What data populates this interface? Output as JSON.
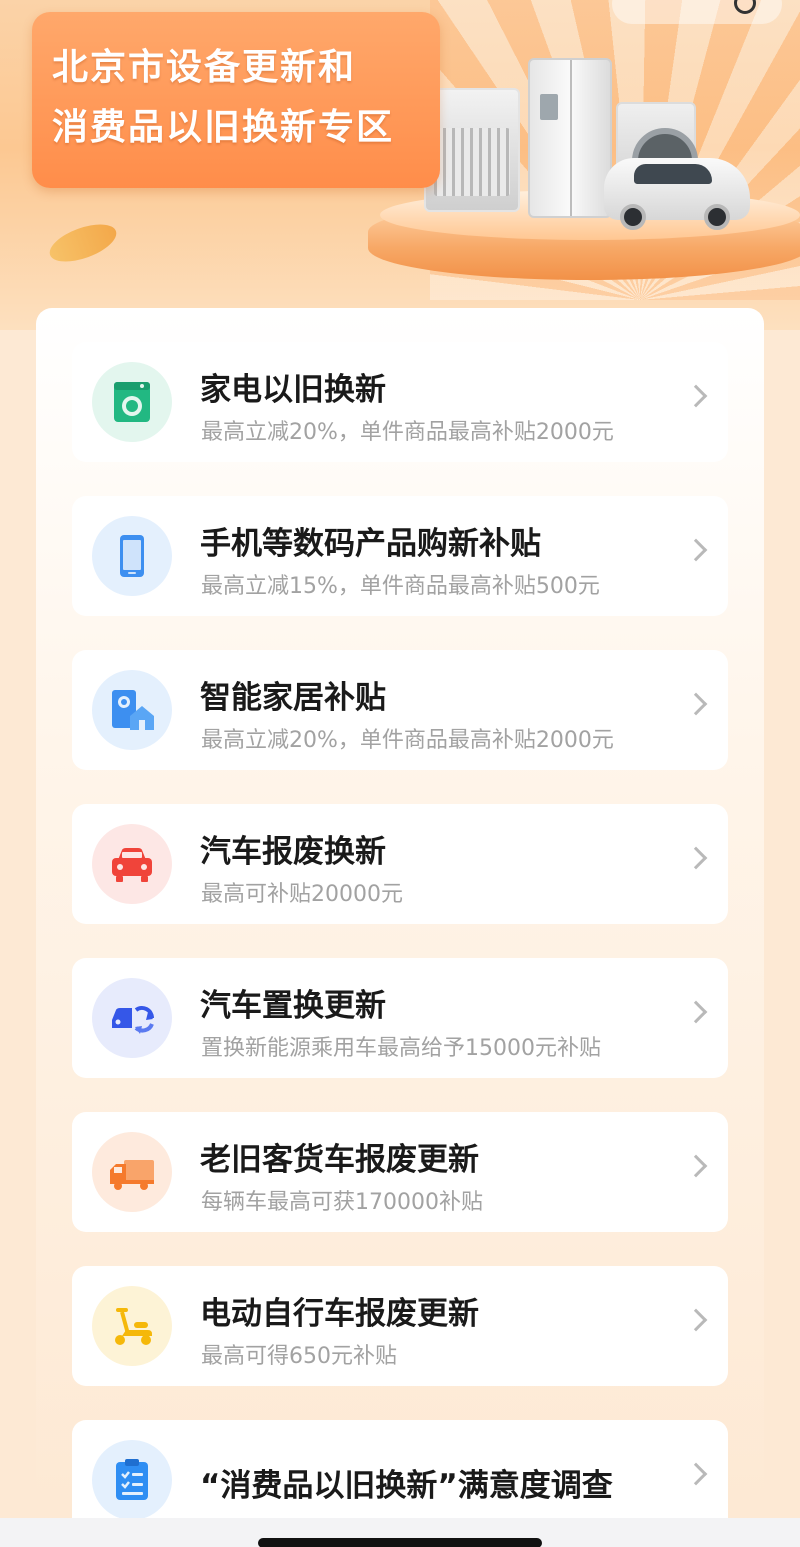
{
  "banner": {
    "title_line1": "北京市设备更新和",
    "title_line2": "消费品以旧换新专区"
  },
  "colors": {
    "banner_orange": "#ff8d4a",
    "appliance_green": "#22b882",
    "phone_blue": "#3d8ff0",
    "car_red": "#f0443a",
    "car_swap_blue": "#3557e8",
    "truck_orange": "#f57a2c",
    "scooter_yellow": "#f5b80a",
    "survey_blue": "#2f8ef3"
  },
  "items": [
    {
      "title": "家电以旧换新",
      "subtitle": "最高立减20%，单件商品最高补贴2000元",
      "icon": "washing-machine-icon"
    },
    {
      "title": "手机等数码产品购新补贴",
      "subtitle": "最高立减15%，单件商品最高补贴500元",
      "icon": "phone-icon"
    },
    {
      "title": "智能家居补贴",
      "subtitle": "最高立减20%，单件商品最高补贴2000元",
      "icon": "smart-home-icon"
    },
    {
      "title": "汽车报废换新",
      "subtitle": "最高可补贴20000元",
      "icon": "car-icon"
    },
    {
      "title": "汽车置换更新",
      "subtitle": "置换新能源乘用车最高给予15000元补贴",
      "icon": "car-swap-icon"
    },
    {
      "title": "老旧客货车报废更新",
      "subtitle": "每辆车最高可获170000补贴",
      "icon": "truck-icon"
    },
    {
      "title": "电动自行车报废更新",
      "subtitle": "最高可得650元补贴",
      "icon": "scooter-icon"
    },
    {
      "title": "“消费品以旧换新”满意度调查",
      "subtitle": "",
      "icon": "survey-icon"
    }
  ]
}
